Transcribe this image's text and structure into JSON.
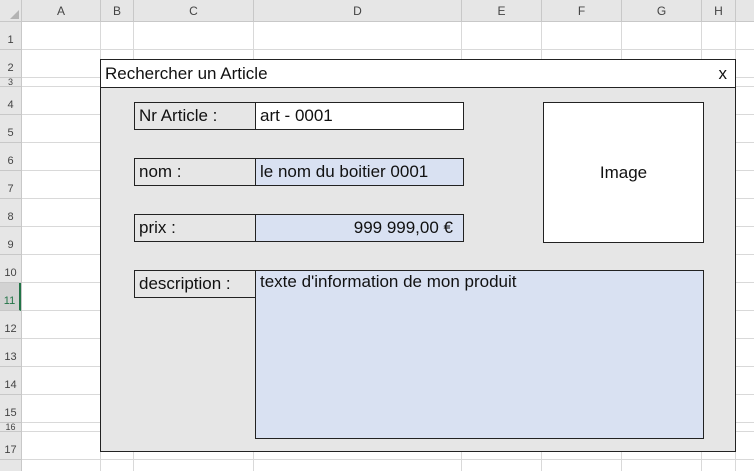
{
  "columns": [
    "A",
    "B",
    "C",
    "D",
    "E",
    "F",
    "G",
    "H"
  ],
  "rows": [
    "1",
    "2",
    "3",
    "4",
    "5",
    "6",
    "7",
    "8",
    "9",
    "10",
    "11",
    "12",
    "13",
    "14",
    "15",
    "16",
    "17"
  ],
  "selected_row": "11",
  "form": {
    "title": "Rechercher un Article",
    "close_label": "x",
    "fields": {
      "nr_article": {
        "label": "Nr Article :",
        "value": "art - 0001"
      },
      "nom": {
        "label": "nom :",
        "value": "le nom du boitier 0001"
      },
      "prix": {
        "label": "prix :",
        "value": "999 999,00 €"
      },
      "description": {
        "label": "description :",
        "value": "texte d'information de mon produit"
      }
    },
    "image_label": "Image"
  },
  "colors": {
    "form_bg": "#e6e6e6",
    "field_blue": "#d9e1f2",
    "excel_green": "#217346"
  }
}
